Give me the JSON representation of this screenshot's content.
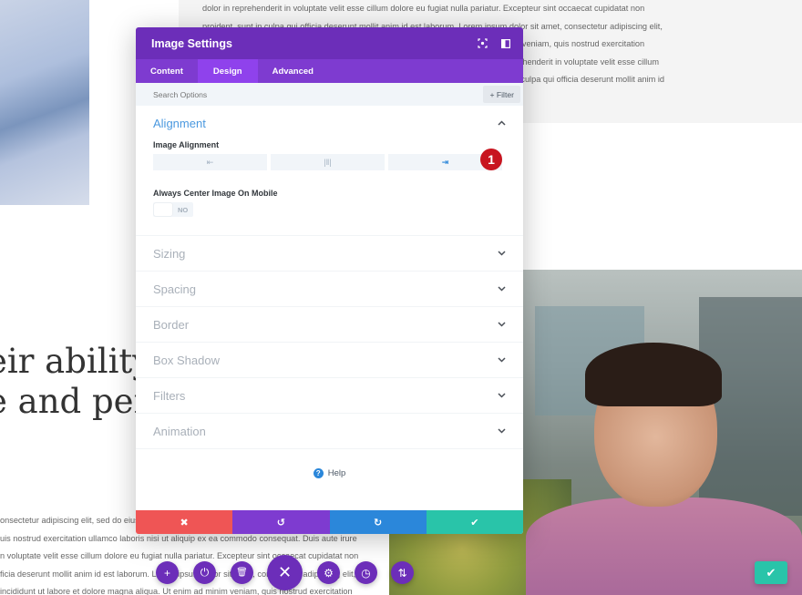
{
  "background": {
    "top_paragraph": [
      "dolor in reprehenderit in voluptate velit esse cillum dolore eu fugiat nulla pariatur. Excepteur sint occaecat cupidatat non",
      "proident, sunt in culpa qui officia deserunt mollit anim id est laborum. Lorem ipsum dolor sit amet, consectetur adipiscing elit,",
      "sed do eiusmod tempor incididunt ut labore et dolore magna aliqua. Ut enim ad minim veniam, quis nostrud exercitation",
      "ullamco laboris nisi ut aliquip ex ea commodo consequat. Duis aute irure dolor in reprehenderit in voluptate velit esse cillum",
      "dolore eu fugiat nulla pariatur. Excepteur sint occaecat cupidatat non proident, sunt in culpa qui officia deserunt mollit anim id"
    ],
    "heading_lines": [
      "eir ability t",
      "e and perfo"
    ],
    "bottom_paragraph": [
      "onsectetur adipiscing elit, sed do eiusmod tempor incididunt ut labore et dolore magna aliqua. Ut enim ad minim veniam, q",
      "uis nostrud exercitation ullamco laboris nisi ut aliquip ex ea commodo consequat. Duis aute irure",
      "n voluptate velit esse cillum dolore eu fugiat nulla pariatur. Excepteur sint occaecat cupidatat non",
      "ficia deserunt mollit anim id est laborum. Lorem ipsum dolor sit amet, consectetur adipiscing elit,",
      " incididunt ut labore et dolore magna aliqua. Ut enim ad minim veniam, quis nostrud exercitation"
    ]
  },
  "modal": {
    "title": "Image Settings",
    "header_icons": [
      "fullscreen-icon",
      "sidebar-toggle-icon"
    ],
    "tabs": [
      {
        "label": "Content",
        "active": false
      },
      {
        "label": "Design",
        "active": true
      },
      {
        "label": "Advanced",
        "active": false
      }
    ],
    "search": {
      "placeholder": "Search Options",
      "value": ""
    },
    "filter_label": "+ Filter",
    "open_section": {
      "title": "Alignment",
      "image_alignment_label": "Image Alignment",
      "alignment_options": [
        {
          "name": "left",
          "glyph": "⇤",
          "active": false
        },
        {
          "name": "center",
          "glyph": "|‖|",
          "active": false
        },
        {
          "name": "right",
          "glyph": "⇥",
          "active": true
        }
      ],
      "badge_number": "1",
      "mobile_center_label": "Always Center Image On Mobile",
      "mobile_center_value": "NO"
    },
    "sections": [
      "Sizing",
      "Spacing",
      "Border",
      "Box Shadow",
      "Filters",
      "Animation"
    ],
    "help_label": "Help",
    "actions": {
      "cancel": "✖",
      "undo": "↺",
      "redo": "↻",
      "save": "✔"
    },
    "colors": {
      "header": "#6c2eb9",
      "tabs": "#7e3bd0",
      "accent_blue": "#2b87da",
      "cancel_red": "#ef5555",
      "save_green": "#29c4a9",
      "badge_red": "#c8141f"
    }
  },
  "bottom_toolbar": {
    "buttons": [
      {
        "name": "add",
        "glyph": "+"
      },
      {
        "name": "power",
        "glyph": "⏻"
      },
      {
        "name": "trash",
        "glyph": "🗑"
      },
      {
        "name": "close",
        "glyph": "✕"
      },
      {
        "name": "settings",
        "glyph": "⚙"
      },
      {
        "name": "history",
        "glyph": "◷"
      },
      {
        "name": "reorder",
        "glyph": "⇅"
      }
    ]
  },
  "corner_save_glyph": "✔"
}
